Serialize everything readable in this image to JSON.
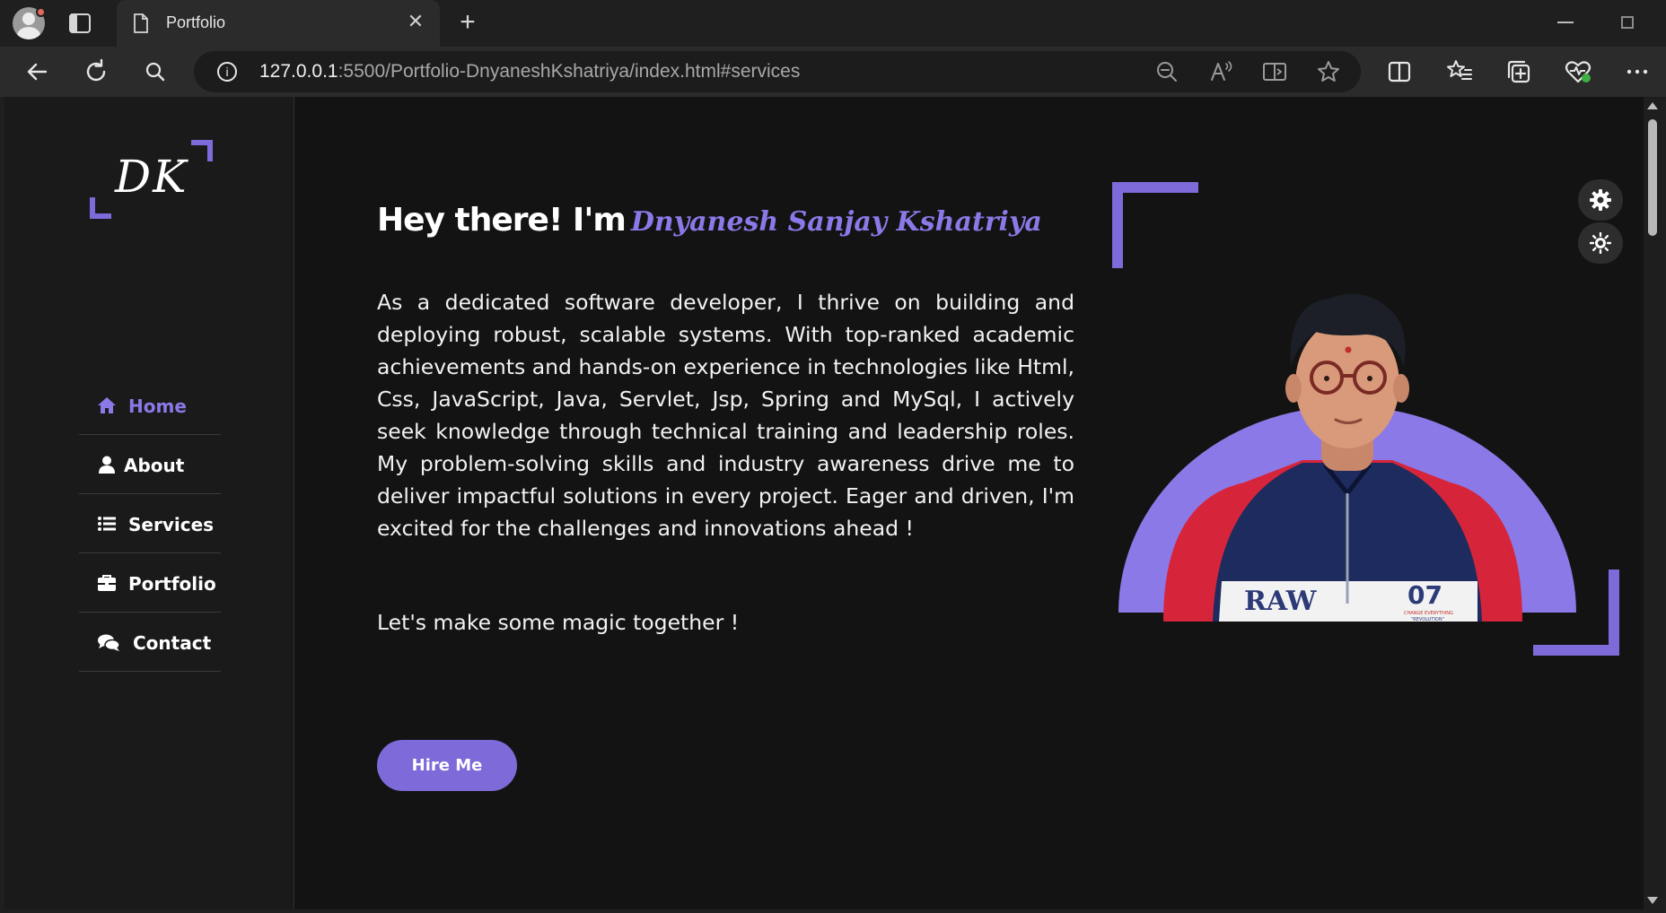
{
  "browser": {
    "tab_title": "Portfolio",
    "url_host": "127.0.0.1",
    "url_rest": ":5500/Portfolio-DnyaneshKshatriya/index.html#services",
    "colors": {
      "titlebar": "#1f1f1f",
      "toolbar": "#2b2b2b",
      "urlbar": "#1c1c1c"
    },
    "icons": [
      "profile-icon",
      "tab-actions-icon",
      "document-icon",
      "close-icon",
      "plus-icon",
      "minimize-icon",
      "restore-icon",
      "back-icon",
      "refresh-icon",
      "search-icon",
      "info-icon",
      "zoom-out-icon",
      "read-aloud-icon",
      "immersive-reader-icon",
      "star-icon",
      "split-screen-icon",
      "favorites-icon",
      "collections-icon",
      "browser-essentials-icon",
      "more-icon"
    ]
  },
  "sidebar": {
    "logo_text": "DK",
    "nav": [
      {
        "label": "Home",
        "icon": "home-icon",
        "active": true
      },
      {
        "label": "About",
        "icon": "user-icon",
        "active": false
      },
      {
        "label": "Services",
        "icon": "list-icon",
        "active": false
      },
      {
        "label": "Portfolio",
        "icon": "briefcase-icon",
        "active": false
      },
      {
        "label": "Contact",
        "icon": "comments-icon",
        "active": false
      }
    ]
  },
  "hero": {
    "greeting": "Hey there! I'm",
    "name": "Dnyanesh Sanjay Kshatriya",
    "bio": "As a dedicated software developer, I thrive on building and deploying robust, scalable systems. With top-ranked academic achievements and hands-on experience in technologies like Html, Css, JavaScript, Java, Servlet, Jsp, Spring and MySql, I actively seek knowledge through technical training and leadership roles. My problem-solving skills and industry awareness drive me to deliver impactful solutions in every project. Eager and driven, I'm excited for the challenges and innovations ahead !",
    "tagline": "Let's make some magic together !",
    "button": "Hire Me",
    "portrait_text": {
      "brand": "RAW",
      "number": "07",
      "small": "CHANGE EVERYTHING",
      "small2": "\"REVOLUTION\""
    },
    "accent": "#7e6ad9",
    "background": "#131313"
  },
  "settings": {
    "icons": [
      "settings-gear-icon",
      "theme-toggle-icon"
    ]
  }
}
